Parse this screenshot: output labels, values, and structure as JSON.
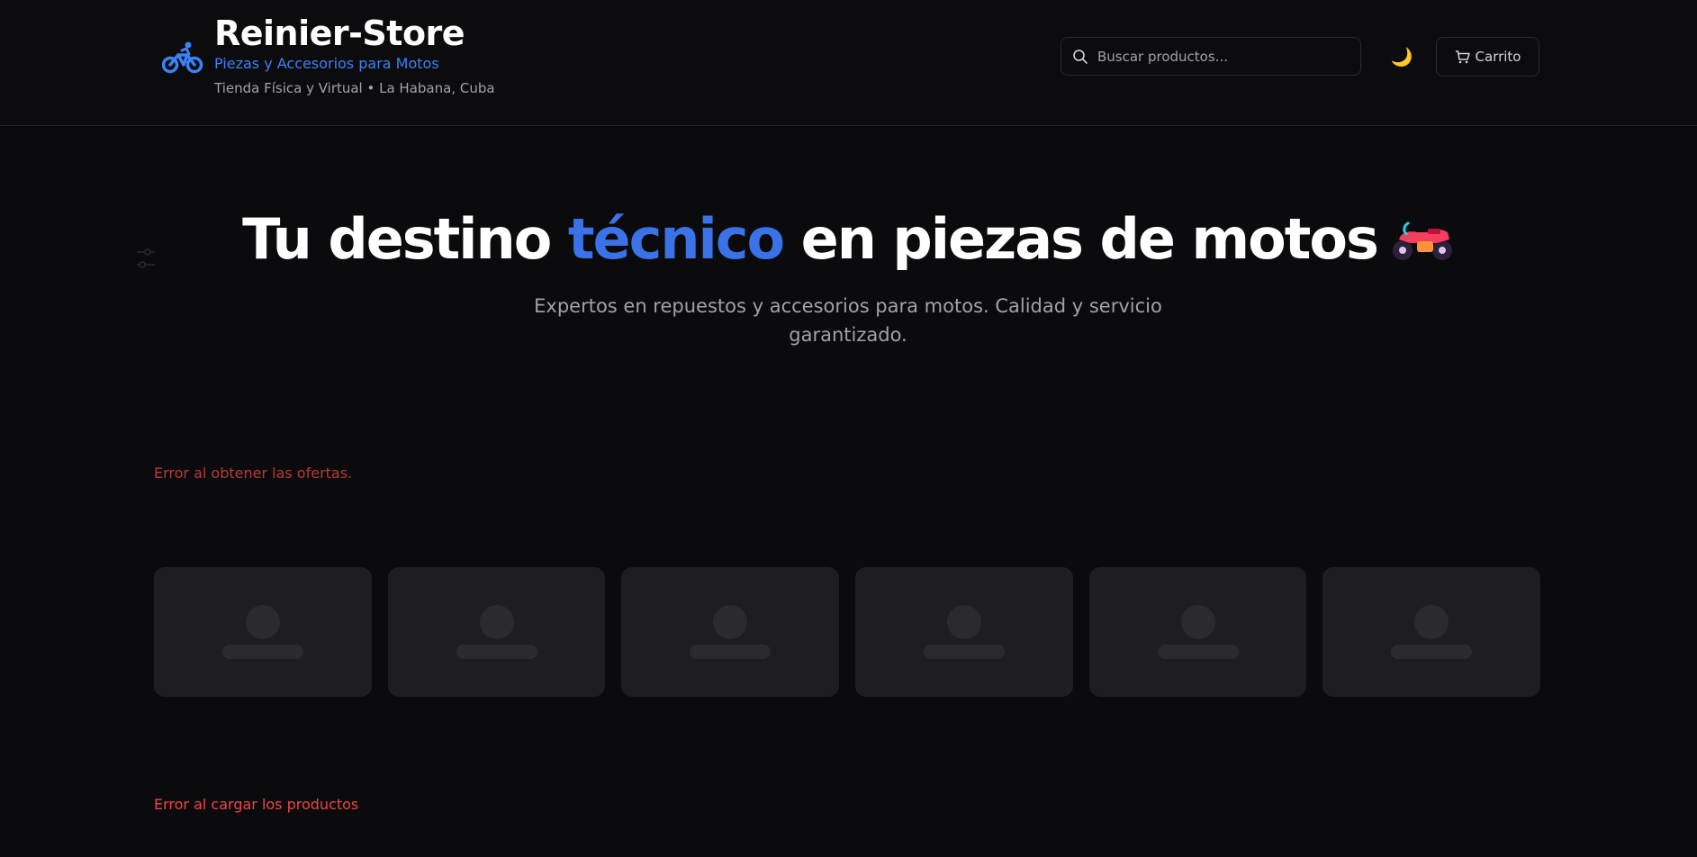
{
  "header": {
    "title": "Reinier-Store",
    "subtitle": "Piezas y Accesorios para Motos",
    "location": "Tienda Física y Virtual • La Habana, Cuba",
    "brand_icon": "bicycle-icon",
    "search": {
      "placeholder": "Buscar productos...",
      "value": ""
    },
    "theme_toggle": {
      "icon": "moon-icon",
      "glyph": "🌙"
    },
    "cart": {
      "label": "Carrito",
      "icon": "cart-icon"
    }
  },
  "hero": {
    "title_before": "Tu destino ",
    "title_accent": "técnico",
    "title_after": " en piezas de motos",
    "title_icon": "motorcycle-icon",
    "subtitle": "Expertos en repuestos y accesorios para motos. Calidad y servicio garantizado."
  },
  "offers": {
    "error": "Error al obtener las ofertas."
  },
  "skeleton_cards": [
    {},
    {},
    {},
    {},
    {},
    {}
  ],
  "products": {
    "error": "Error al cargar los productos"
  },
  "colors": {
    "background": "#0b0b0d",
    "accent": "#3b82f6",
    "card": "#1e1e22",
    "error": "#ef4444",
    "moon": "#f5c542"
  }
}
